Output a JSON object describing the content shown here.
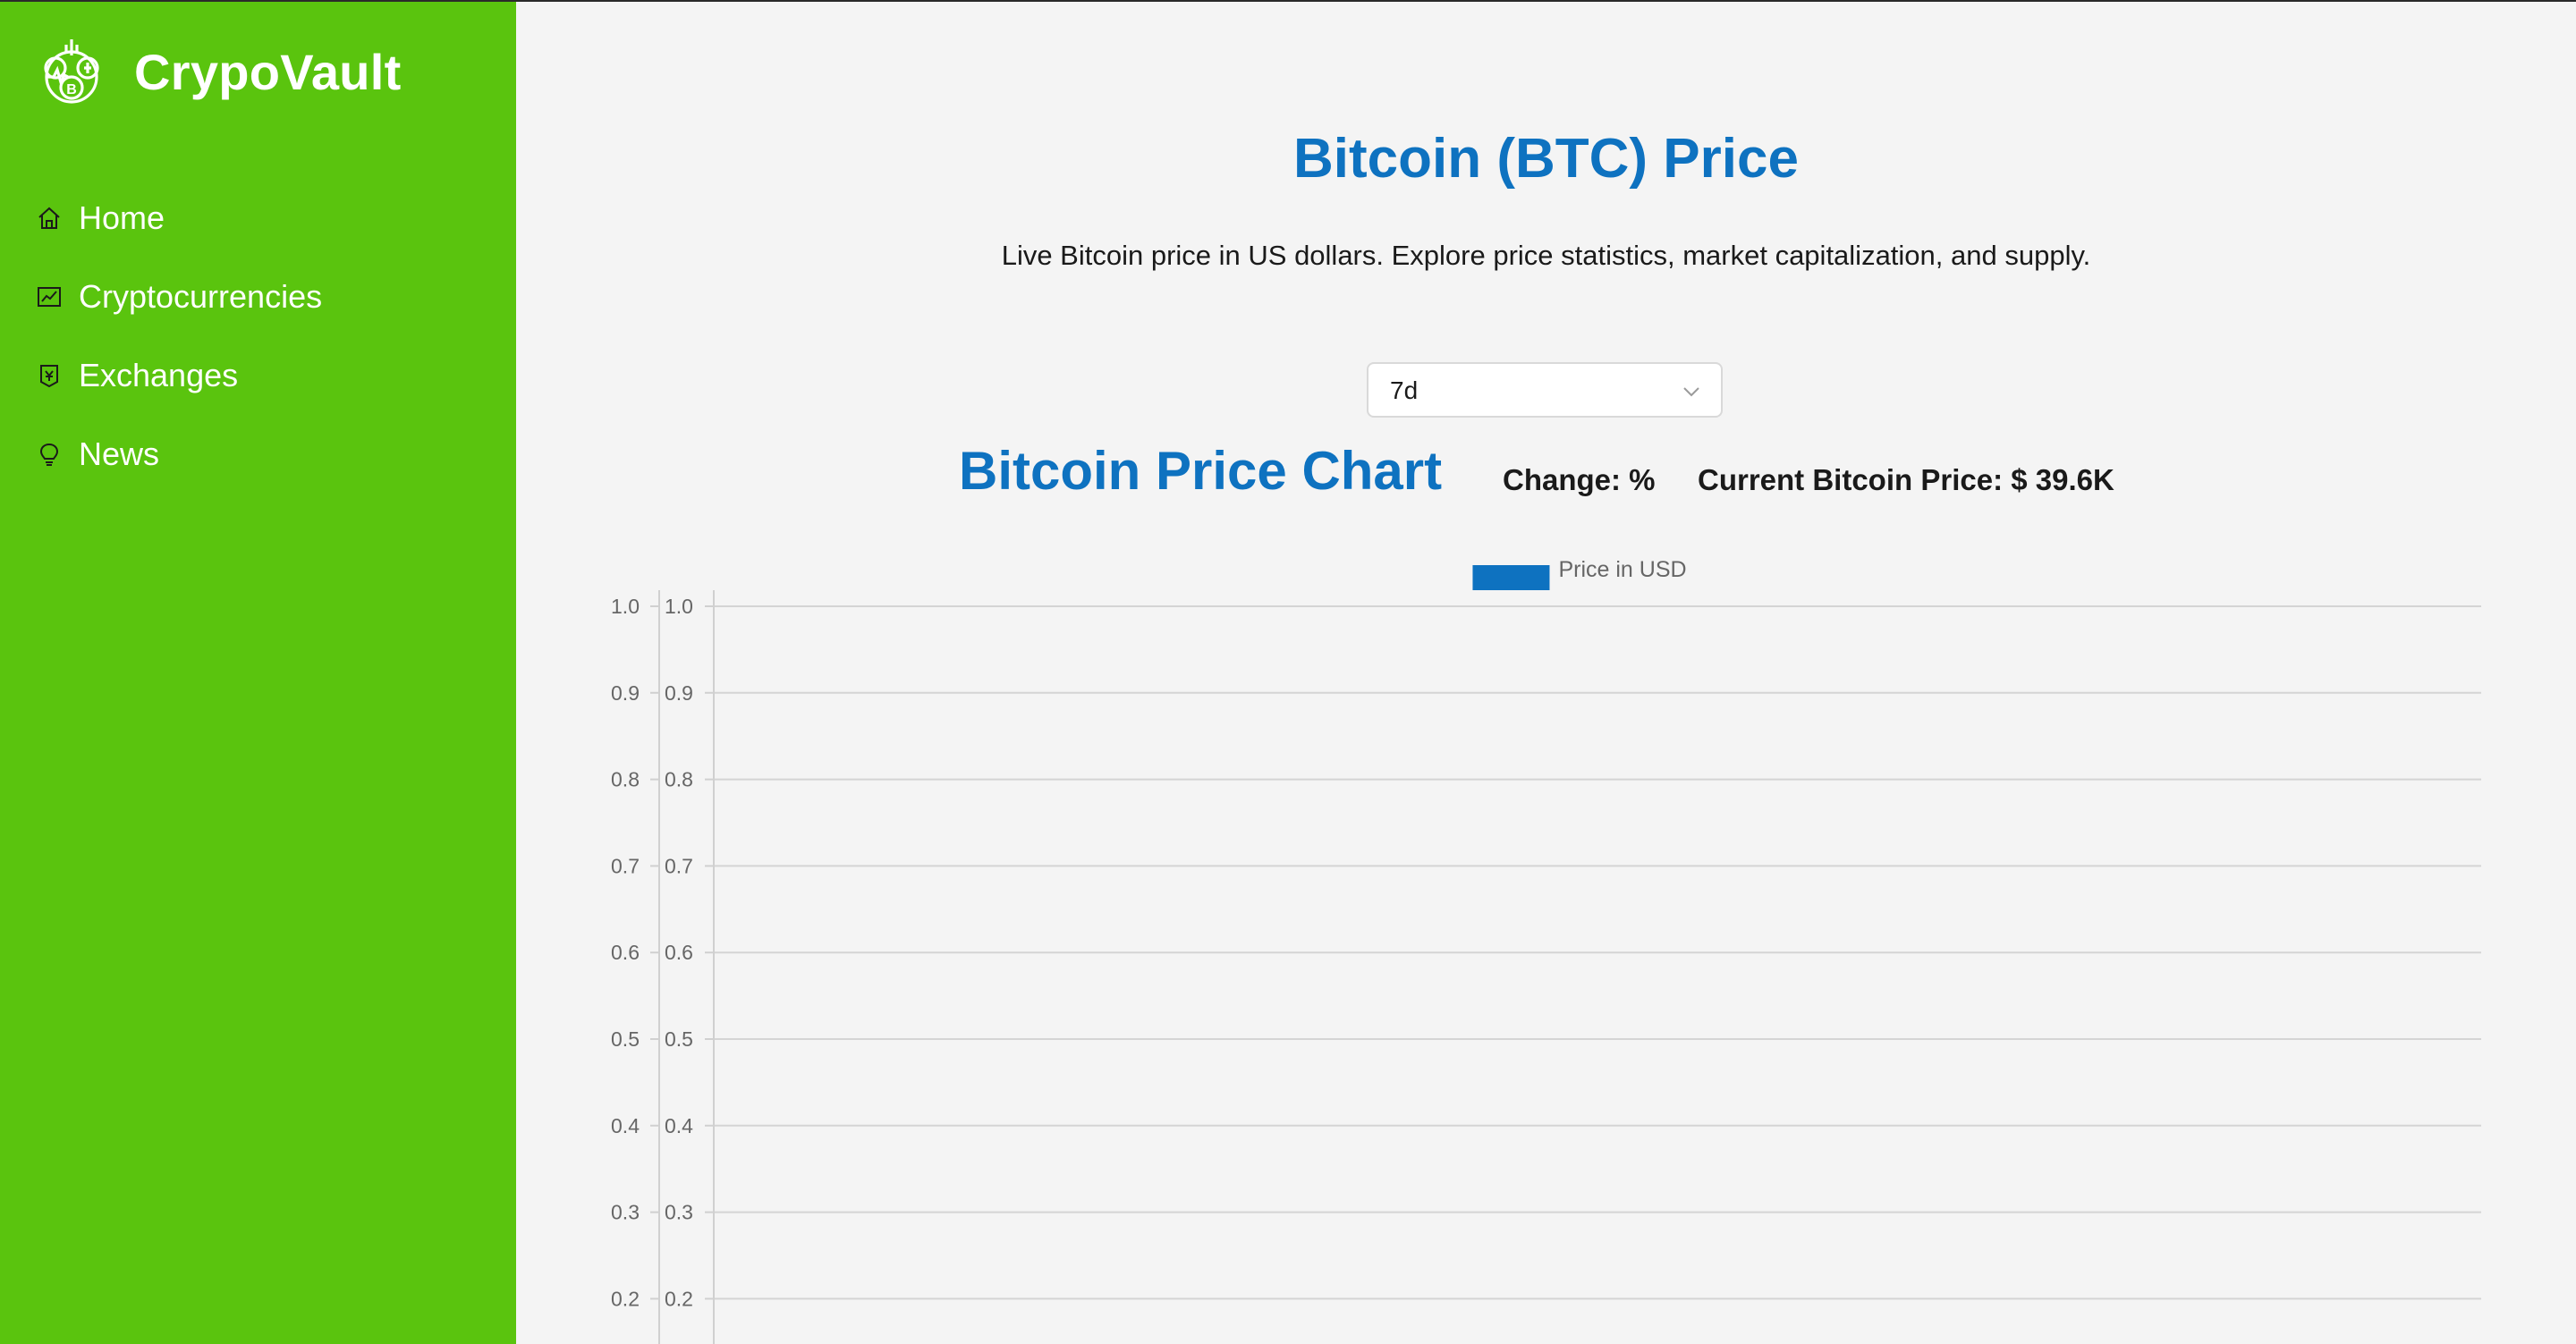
{
  "colors": {
    "sidebar": "#5ac40e",
    "accent": "#0e72c0",
    "background": "#f4f4f4"
  },
  "brand": {
    "name": "CrypoVault",
    "logo_icon": "crypto-coins-logo-icon"
  },
  "sidebar": {
    "items": [
      {
        "label": "Home",
        "icon": "home-icon"
      },
      {
        "label": "Cryptocurrencies",
        "icon": "line-chart-icon"
      },
      {
        "label": "Exchanges",
        "icon": "money-collect-icon"
      },
      {
        "label": "News",
        "icon": "bulb-icon"
      }
    ]
  },
  "main": {
    "title": "Bitcoin (BTC) Price",
    "subtitle": "Live Bitcoin price in US dollars. Explore price statistics, market capitalization, and supply.",
    "time_period": {
      "selected": "7d",
      "icon": "chevron-down-icon"
    },
    "chart_heading": "Bitcoin Price Chart",
    "change_text": "Change: %",
    "current_price_text": "Current Bitcoin Price: $ 39.6K"
  },
  "chart_data": {
    "type": "line",
    "title": "",
    "xlabel": "",
    "ylabel": "",
    "categories": [],
    "series": [
      {
        "name": "Price in USD",
        "values": [],
        "color": "#0e72c0"
      }
    ],
    "legend_position": "top-center",
    "grid": true,
    "ylim": [
      0,
      1.0
    ],
    "y_ticks": [
      "1.0",
      "0.9",
      "0.8",
      "0.7",
      "0.6",
      "0.5",
      "0.4",
      "0.3",
      "0.2"
    ]
  }
}
